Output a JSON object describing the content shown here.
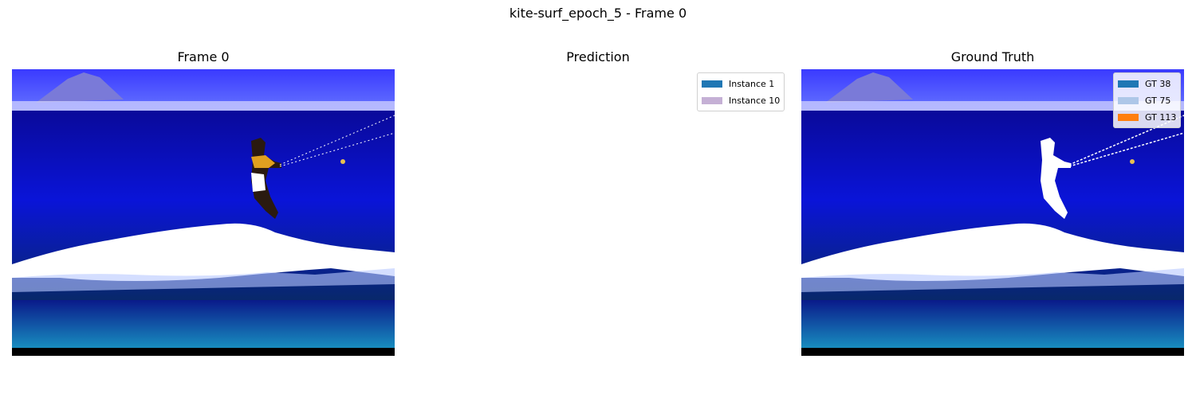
{
  "figure": {
    "suptitle": "kite-surf_epoch_5 - Frame 0"
  },
  "panels": {
    "frame": {
      "title": "Frame 0"
    },
    "prediction": {
      "title": "Prediction",
      "legend": [
        {
          "label": "Instance 1",
          "color": "#1f77b4"
        },
        {
          "label": "Instance 10",
          "color": "#c5b0d5"
        }
      ]
    },
    "ground_truth": {
      "title": "Ground Truth",
      "legend": [
        {
          "label": "GT 38",
          "color": "#1f77b4"
        },
        {
          "label": "GT 75",
          "color": "#aec7e8"
        },
        {
          "label": "GT 113",
          "color": "#ff7f0e"
        }
      ]
    }
  }
}
